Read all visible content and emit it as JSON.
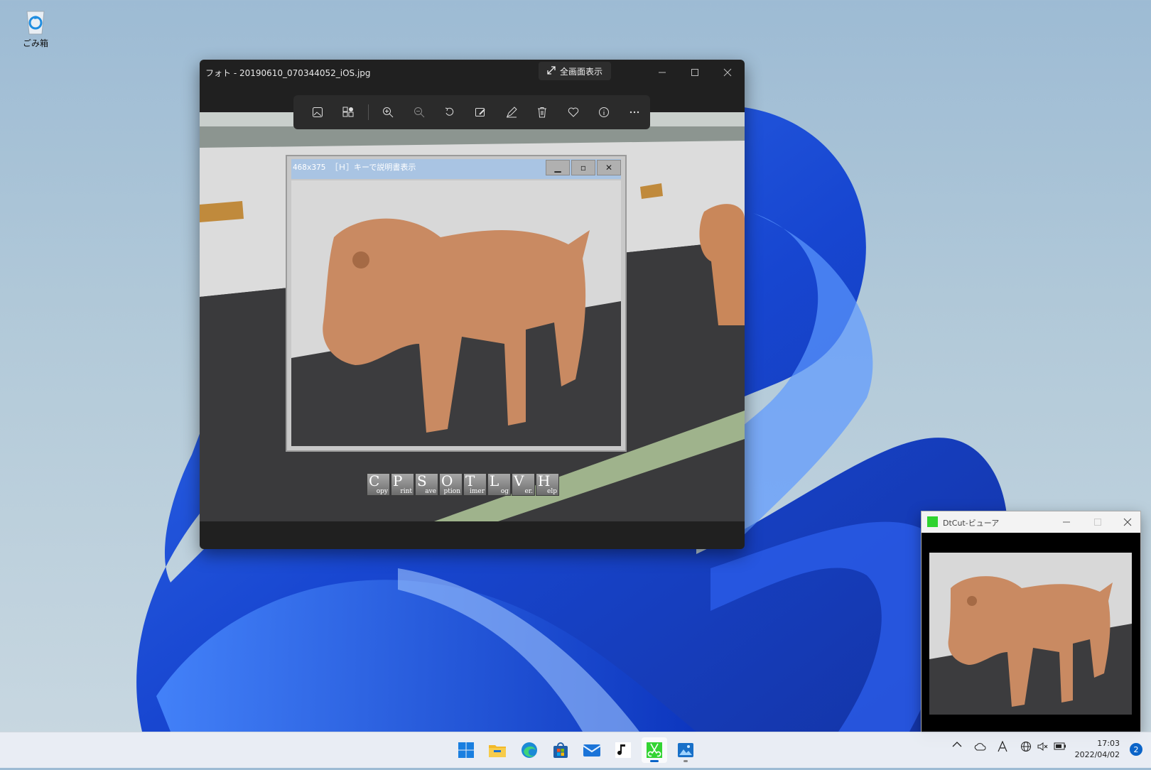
{
  "desktop": {
    "recycle_bin_label": "ごみ箱"
  },
  "photos_window": {
    "title": "フォト - 20190610_070344052_iOS.jpg",
    "fullscreen_label": "全画面表示",
    "toolbar_icons": [
      "picture-icon",
      "collection-icon",
      "zoom-in-icon",
      "zoom-out-icon",
      "rotate-icon",
      "edit-image-icon",
      "draw-icon",
      "delete-icon",
      "favorite-icon",
      "info-icon",
      "more-icon"
    ]
  },
  "dtcut_overlay": {
    "bar_text": "468x375 ［Ｈ］キーで説明書表示",
    "buttons": [
      {
        "key": "C",
        "label": "opy"
      },
      {
        "key": "P",
        "label": "rint"
      },
      {
        "key": "S",
        "label": "ave"
      },
      {
        "key": "O",
        "label": "ption"
      },
      {
        "key": "T",
        "label": "imer"
      },
      {
        "key": "L",
        "label": "og"
      },
      {
        "key": "V",
        "label": "er."
      },
      {
        "key": "H",
        "label": "elp"
      }
    ]
  },
  "viewer_window": {
    "title": "DtCut-ビューア"
  },
  "taskbar": {
    "apps": [
      "start-icon",
      "file-explorer-icon",
      "edge-icon",
      "store-icon",
      "mail-icon",
      "music-icon",
      "dtcut-icon",
      "photos-icon"
    ],
    "time": "17:03",
    "date": "2022/04/02",
    "notification_count": "2"
  }
}
